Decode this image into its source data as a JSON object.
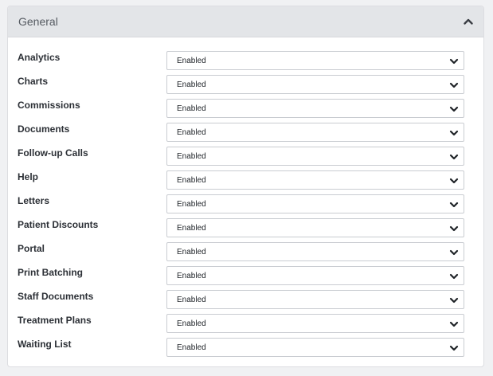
{
  "section": {
    "title": "General",
    "collapse_icon": "chevron-up-icon"
  },
  "settings": [
    {
      "label": "Analytics",
      "value": "Enabled"
    },
    {
      "label": "Charts",
      "value": "Enabled"
    },
    {
      "label": "Commissions",
      "value": "Enabled"
    },
    {
      "label": "Documents",
      "value": "Enabled"
    },
    {
      "label": "Follow-up Calls",
      "value": "Enabled"
    },
    {
      "label": "Help",
      "value": "Enabled"
    },
    {
      "label": "Letters",
      "value": "Enabled"
    },
    {
      "label": "Patient Discounts",
      "value": "Enabled"
    },
    {
      "label": "Portal",
      "value": "Enabled"
    },
    {
      "label": "Print Batching",
      "value": "Enabled"
    },
    {
      "label": "Staff Documents",
      "value": "Enabled"
    },
    {
      "label": "Treatment Plans",
      "value": "Enabled"
    },
    {
      "label": "Waiting List",
      "value": "Enabled"
    }
  ],
  "dropdown_icon": "chevron-down-icon"
}
